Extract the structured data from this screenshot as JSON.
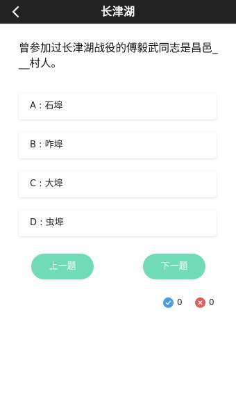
{
  "header": {
    "title": "长津湖"
  },
  "question": {
    "text": "曾参加过长津湖战役的傅毅武同志是昌邑___村人。"
  },
  "options": [
    {
      "label": "A : 石埠"
    },
    {
      "label": "B : 咋埠"
    },
    {
      "label": "C : 大埠"
    },
    {
      "label": "D : 虫埠"
    }
  ],
  "navigation": {
    "prev_label": "上一题",
    "next_label": "下一题"
  },
  "score": {
    "correct": "0",
    "wrong": "0"
  },
  "colors": {
    "header_bg": "#222222",
    "button_bg": "#6fdcb7",
    "correct_icon": "#4a9ee0",
    "wrong_icon": "#e0605c"
  },
  "icons": {
    "back": "chevron-left-icon",
    "correct": "check-circle-icon",
    "wrong": "cross-circle-icon"
  }
}
